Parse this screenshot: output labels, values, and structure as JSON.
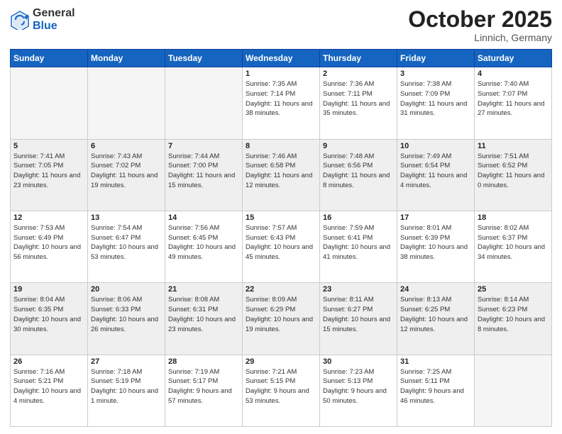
{
  "header": {
    "logo_general": "General",
    "logo_blue": "Blue",
    "month": "October 2025",
    "location": "Linnich, Germany"
  },
  "days_of_week": [
    "Sunday",
    "Monday",
    "Tuesday",
    "Wednesday",
    "Thursday",
    "Friday",
    "Saturday"
  ],
  "weeks": [
    [
      {
        "day": "",
        "sunrise": "",
        "sunset": "",
        "daylight": "",
        "empty": true
      },
      {
        "day": "",
        "sunrise": "",
        "sunset": "",
        "daylight": "",
        "empty": true
      },
      {
        "day": "",
        "sunrise": "",
        "sunset": "",
        "daylight": "",
        "empty": true
      },
      {
        "day": "1",
        "sunrise": "Sunrise: 7:35 AM",
        "sunset": "Sunset: 7:14 PM",
        "daylight": "Daylight: 11 hours and 38 minutes.",
        "empty": false
      },
      {
        "day": "2",
        "sunrise": "Sunrise: 7:36 AM",
        "sunset": "Sunset: 7:11 PM",
        "daylight": "Daylight: 11 hours and 35 minutes.",
        "empty": false
      },
      {
        "day": "3",
        "sunrise": "Sunrise: 7:38 AM",
        "sunset": "Sunset: 7:09 PM",
        "daylight": "Daylight: 11 hours and 31 minutes.",
        "empty": false
      },
      {
        "day": "4",
        "sunrise": "Sunrise: 7:40 AM",
        "sunset": "Sunset: 7:07 PM",
        "daylight": "Daylight: 11 hours and 27 minutes.",
        "empty": false
      }
    ],
    [
      {
        "day": "5",
        "sunrise": "Sunrise: 7:41 AM",
        "sunset": "Sunset: 7:05 PM",
        "daylight": "Daylight: 11 hours and 23 minutes.",
        "empty": false
      },
      {
        "day": "6",
        "sunrise": "Sunrise: 7:43 AM",
        "sunset": "Sunset: 7:02 PM",
        "daylight": "Daylight: 11 hours and 19 minutes.",
        "empty": false
      },
      {
        "day": "7",
        "sunrise": "Sunrise: 7:44 AM",
        "sunset": "Sunset: 7:00 PM",
        "daylight": "Daylight: 11 hours and 15 minutes.",
        "empty": false
      },
      {
        "day": "8",
        "sunrise": "Sunrise: 7:46 AM",
        "sunset": "Sunset: 6:58 PM",
        "daylight": "Daylight: 11 hours and 12 minutes.",
        "empty": false
      },
      {
        "day": "9",
        "sunrise": "Sunrise: 7:48 AM",
        "sunset": "Sunset: 6:56 PM",
        "daylight": "Daylight: 11 hours and 8 minutes.",
        "empty": false
      },
      {
        "day": "10",
        "sunrise": "Sunrise: 7:49 AM",
        "sunset": "Sunset: 6:54 PM",
        "daylight": "Daylight: 11 hours and 4 minutes.",
        "empty": false
      },
      {
        "day": "11",
        "sunrise": "Sunrise: 7:51 AM",
        "sunset": "Sunset: 6:52 PM",
        "daylight": "Daylight: 11 hours and 0 minutes.",
        "empty": false
      }
    ],
    [
      {
        "day": "12",
        "sunrise": "Sunrise: 7:53 AM",
        "sunset": "Sunset: 6:49 PM",
        "daylight": "Daylight: 10 hours and 56 minutes.",
        "empty": false
      },
      {
        "day": "13",
        "sunrise": "Sunrise: 7:54 AM",
        "sunset": "Sunset: 6:47 PM",
        "daylight": "Daylight: 10 hours and 53 minutes.",
        "empty": false
      },
      {
        "day": "14",
        "sunrise": "Sunrise: 7:56 AM",
        "sunset": "Sunset: 6:45 PM",
        "daylight": "Daylight: 10 hours and 49 minutes.",
        "empty": false
      },
      {
        "day": "15",
        "sunrise": "Sunrise: 7:57 AM",
        "sunset": "Sunset: 6:43 PM",
        "daylight": "Daylight: 10 hours and 45 minutes.",
        "empty": false
      },
      {
        "day": "16",
        "sunrise": "Sunrise: 7:59 AM",
        "sunset": "Sunset: 6:41 PM",
        "daylight": "Daylight: 10 hours and 41 minutes.",
        "empty": false
      },
      {
        "day": "17",
        "sunrise": "Sunrise: 8:01 AM",
        "sunset": "Sunset: 6:39 PM",
        "daylight": "Daylight: 10 hours and 38 minutes.",
        "empty": false
      },
      {
        "day": "18",
        "sunrise": "Sunrise: 8:02 AM",
        "sunset": "Sunset: 6:37 PM",
        "daylight": "Daylight: 10 hours and 34 minutes.",
        "empty": false
      }
    ],
    [
      {
        "day": "19",
        "sunrise": "Sunrise: 8:04 AM",
        "sunset": "Sunset: 6:35 PM",
        "daylight": "Daylight: 10 hours and 30 minutes.",
        "empty": false
      },
      {
        "day": "20",
        "sunrise": "Sunrise: 8:06 AM",
        "sunset": "Sunset: 6:33 PM",
        "daylight": "Daylight: 10 hours and 26 minutes.",
        "empty": false
      },
      {
        "day": "21",
        "sunrise": "Sunrise: 8:08 AM",
        "sunset": "Sunset: 6:31 PM",
        "daylight": "Daylight: 10 hours and 23 minutes.",
        "empty": false
      },
      {
        "day": "22",
        "sunrise": "Sunrise: 8:09 AM",
        "sunset": "Sunset: 6:29 PM",
        "daylight": "Daylight: 10 hours and 19 minutes.",
        "empty": false
      },
      {
        "day": "23",
        "sunrise": "Sunrise: 8:11 AM",
        "sunset": "Sunset: 6:27 PM",
        "daylight": "Daylight: 10 hours and 15 minutes.",
        "empty": false
      },
      {
        "day": "24",
        "sunrise": "Sunrise: 8:13 AM",
        "sunset": "Sunset: 6:25 PM",
        "daylight": "Daylight: 10 hours and 12 minutes.",
        "empty": false
      },
      {
        "day": "25",
        "sunrise": "Sunrise: 8:14 AM",
        "sunset": "Sunset: 6:23 PM",
        "daylight": "Daylight: 10 hours and 8 minutes.",
        "empty": false
      }
    ],
    [
      {
        "day": "26",
        "sunrise": "Sunrise: 7:16 AM",
        "sunset": "Sunset: 5:21 PM",
        "daylight": "Daylight: 10 hours and 4 minutes.",
        "empty": false
      },
      {
        "day": "27",
        "sunrise": "Sunrise: 7:18 AM",
        "sunset": "Sunset: 5:19 PM",
        "daylight": "Daylight: 10 hours and 1 minute.",
        "empty": false
      },
      {
        "day": "28",
        "sunrise": "Sunrise: 7:19 AM",
        "sunset": "Sunset: 5:17 PM",
        "daylight": "Daylight: 9 hours and 57 minutes.",
        "empty": false
      },
      {
        "day": "29",
        "sunrise": "Sunrise: 7:21 AM",
        "sunset": "Sunset: 5:15 PM",
        "daylight": "Daylight: 9 hours and 53 minutes.",
        "empty": false
      },
      {
        "day": "30",
        "sunrise": "Sunrise: 7:23 AM",
        "sunset": "Sunset: 5:13 PM",
        "daylight": "Daylight: 9 hours and 50 minutes.",
        "empty": false
      },
      {
        "day": "31",
        "sunrise": "Sunrise: 7:25 AM",
        "sunset": "Sunset: 5:11 PM",
        "daylight": "Daylight: 9 hours and 46 minutes.",
        "empty": false
      },
      {
        "day": "",
        "sunrise": "",
        "sunset": "",
        "daylight": "",
        "empty": true
      }
    ]
  ]
}
